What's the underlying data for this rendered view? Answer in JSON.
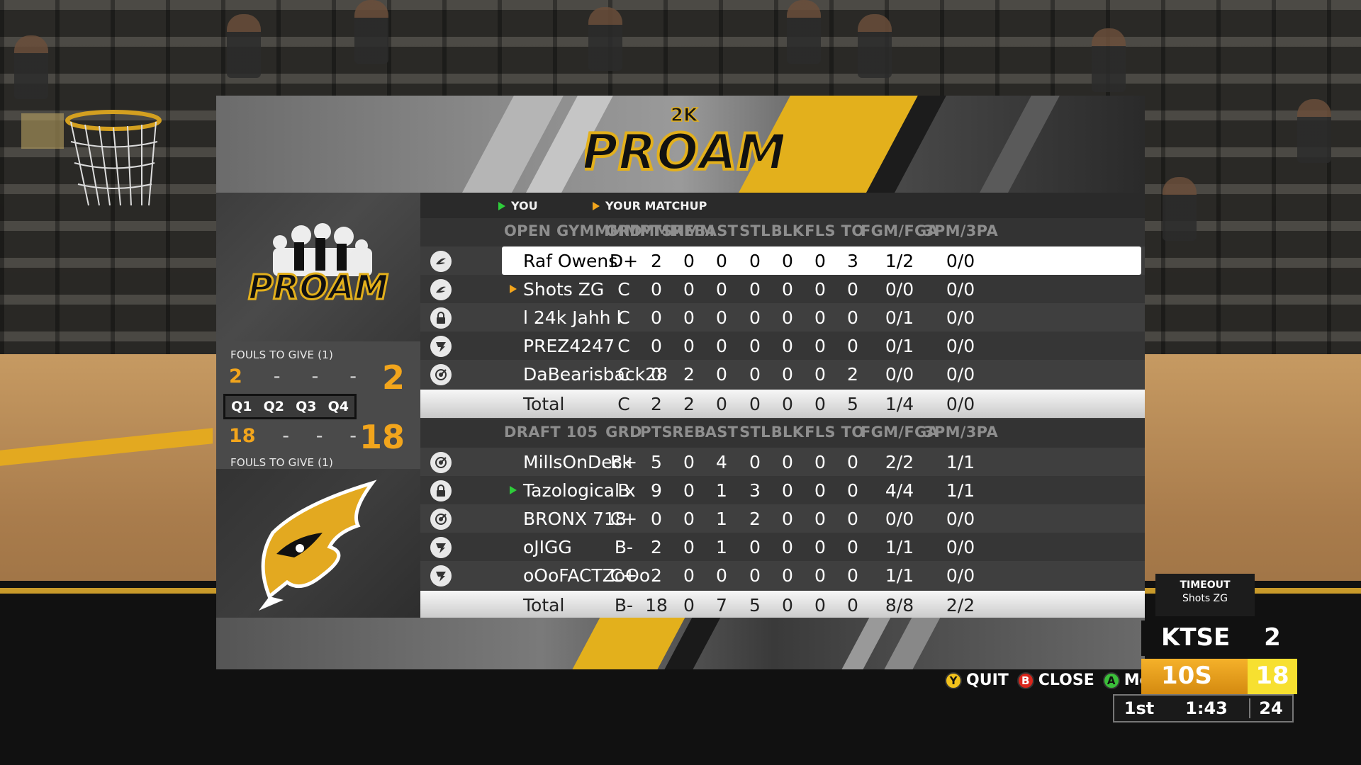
{
  "banner": {
    "logo_top": "2K",
    "logo_main": "PROAM"
  },
  "legend": {
    "you": "YOU",
    "matchup": "YOUR MATCHUP"
  },
  "columns": [
    "GRD",
    "PTS",
    "REB",
    "AST",
    "STL",
    "BLK",
    "FLS",
    "TO",
    "FGM/FGA",
    "3PM/3PA"
  ],
  "team1": {
    "name": "OPEN GYMMMMMMMMM",
    "players": [
      {
        "icon": "wing-icon",
        "name": "Raf Owens",
        "marker": "",
        "stats": [
          "D+",
          "2",
          "0",
          "0",
          "0",
          "0",
          "0",
          "3",
          "1/2",
          "0/0"
        ]
      },
      {
        "icon": "wing-icon",
        "name": "Shots ZG",
        "marker": "matchup",
        "stats": [
          "C",
          "0",
          "0",
          "0",
          "0",
          "0",
          "0",
          "0",
          "0/0",
          "0/0"
        ]
      },
      {
        "icon": "lock-icon",
        "name": "l 24k Jahh l",
        "marker": "",
        "stats": [
          "C",
          "0",
          "0",
          "0",
          "0",
          "0",
          "0",
          "0",
          "0/1",
          "0/0"
        ]
      },
      {
        "icon": "playmaker-icon",
        "name": "PREZ4247",
        "marker": "",
        "stats": [
          "C",
          "0",
          "0",
          "0",
          "0",
          "0",
          "0",
          "0",
          "0/1",
          "0/0"
        ]
      },
      {
        "icon": "target-icon",
        "name": "DaBearisback28",
        "marker": "",
        "stats": [
          "C",
          "0",
          "2",
          "0",
          "0",
          "0",
          "0",
          "2",
          "0/0",
          "0/0"
        ]
      }
    ],
    "total": {
      "label": "Total",
      "stats": [
        "C",
        "2",
        "2",
        "0",
        "0",
        "0",
        "0",
        "5",
        "1/4",
        "0/0"
      ]
    }
  },
  "team2": {
    "name": "DRAFT 105",
    "players": [
      {
        "icon": "target-icon",
        "name": "MillsOnDeck",
        "marker": "",
        "stats": [
          "B+",
          "5",
          "0",
          "4",
          "0",
          "0",
          "0",
          "0",
          "2/2",
          "1/1"
        ]
      },
      {
        "icon": "lock-icon",
        "name": "Tazological x",
        "marker": "you",
        "stats": [
          "B",
          "9",
          "0",
          "1",
          "3",
          "0",
          "0",
          "0",
          "4/4",
          "1/1"
        ]
      },
      {
        "icon": "target-icon",
        "name": "BRONX 718",
        "marker": "",
        "stats": [
          "C+",
          "0",
          "0",
          "1",
          "2",
          "0",
          "0",
          "0",
          "0/0",
          "0/0"
        ]
      },
      {
        "icon": "playmaker-icon",
        "name": "oJIGG",
        "marker": "",
        "stats": [
          "B-",
          "2",
          "0",
          "1",
          "0",
          "0",
          "0",
          "0",
          "1/1",
          "0/0"
        ]
      },
      {
        "icon": "playmaker-icon",
        "name": "oOoFACTZoOo",
        "marker": "",
        "stats": [
          "C+",
          "2",
          "0",
          "0",
          "0",
          "0",
          "0",
          "0",
          "1/1",
          "0/0"
        ]
      }
    ],
    "total": {
      "label": "Total",
      "stats": [
        "B-",
        "18",
        "0",
        "7",
        "5",
        "0",
        "0",
        "0",
        "8/8",
        "2/2"
      ]
    }
  },
  "scorebox": {
    "fouls_top": "FOULS TO GIVE (1)",
    "fouls_bottom": "FOULS TO GIVE (1)",
    "quarters": [
      "Q1",
      "Q2",
      "Q3",
      "Q4"
    ],
    "team1_q": [
      "2",
      "-",
      "-",
      "-"
    ],
    "team2_q": [
      "18",
      "-",
      "-",
      "-"
    ],
    "team1_total": "2",
    "team2_total": "18"
  },
  "controls": {
    "quit_btn": "Y",
    "quit": "QUIT",
    "close_btn": "B",
    "close": "CLOSE",
    "more_btn": "A",
    "more": "More"
  },
  "hud": {
    "timeout_label": "TIMEOUT",
    "timeout_team": "Shots ZG",
    "team1": "KTSE",
    "team1_score": "2",
    "team2": "10S",
    "team2_score": "18",
    "period": "1st",
    "clock": "1:43",
    "shot_clock": "24"
  },
  "colors": {
    "accent": "#f2a51c",
    "you_marker": "#2ecc3a",
    "matchup_marker": "#f2a51c",
    "banner_yellow": "#e3b01c"
  }
}
